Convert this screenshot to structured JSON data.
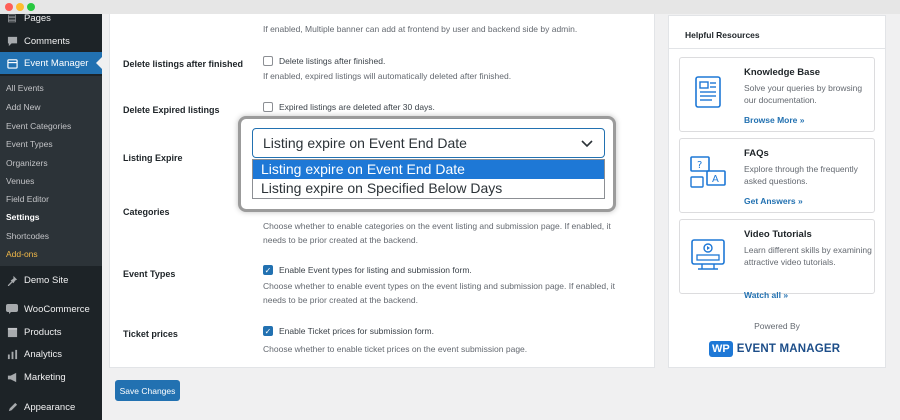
{
  "sidebar": {
    "items": [
      {
        "label": "Pages",
        "icon": "pages-icon"
      },
      {
        "label": "Comments",
        "icon": "comments-icon"
      },
      {
        "label": "Event Manager",
        "icon": "event-manager-icon"
      },
      {
        "label": "Demo Site",
        "icon": "pin-icon"
      },
      {
        "label": "WooCommerce",
        "icon": "woocommerce-icon"
      },
      {
        "label": "Products",
        "icon": "products-icon"
      },
      {
        "label": "Analytics",
        "icon": "analytics-icon"
      },
      {
        "label": "Marketing",
        "icon": "marketing-icon"
      },
      {
        "label": "Appearance",
        "icon": "appearance-icon"
      }
    ],
    "submenu": [
      "All Events",
      "Add New",
      "Event Categories",
      "Event Types",
      "Organizers",
      "Venues",
      "Field Editor",
      "Settings",
      "Shortcodes",
      "Add-ons"
    ]
  },
  "settings": {
    "top_desc": "If enabled, Multiple banner can add at frontend by user and backend side by admin.",
    "delete_after_finished": {
      "label": "Delete listings after finished",
      "checkbox_label": "Delete listings after finished.",
      "desc": "If enabled, expired listings will automatically deleted after finished."
    },
    "delete_expired": {
      "label": "Delete Expired listings",
      "checkbox_label": "Expired listings are deleted after 30 days."
    },
    "listing_expire": {
      "label": "Listing Expire",
      "selected": "Listing expire on Event End Date",
      "options": [
        "Listing expire on Event End Date",
        "Listing expire on Specified Below Days"
      ]
    },
    "categories": {
      "label": "Categories",
      "desc_line1": "Choose whether to enable categories on the event listing and submission page. If enabled, it",
      "desc_line2": "needs to be prior created at the backend."
    },
    "event_types": {
      "label": "Event Types",
      "checkbox_label": "Enable Event types for listing and submission form.",
      "desc_line1": "Choose whether to enable event types on the event listing and submission page. If enabled, it",
      "desc_line2": "needs to be prior created at the backend."
    },
    "ticket_prices": {
      "label": "Ticket prices",
      "checkbox_label": "Enable Ticket prices for submission form.",
      "desc": "Choose whether to enable ticket prices on the event submission page."
    },
    "save_label": "Save Changes"
  },
  "resources": {
    "title": "Helpful Resources",
    "cards": [
      {
        "title": "Knowledge Base",
        "text": "Solve your queries by browsing our documentation.",
        "link": "Browse More »",
        "icon": "knowledge-base-icon"
      },
      {
        "title": "FAQs",
        "text": "Explore through the frequently asked questions.",
        "link": "Get Answers »",
        "icon": "faq-icon"
      },
      {
        "title": "Video Tutorials",
        "text": "Learn different skills by examining attractive video tutorials.",
        "link": "Watch all »",
        "icon": "video-tutorial-icon"
      }
    ],
    "powered_by": "Powered By",
    "logo_badge": "WP",
    "logo_text": "EVENT MANAGER"
  },
  "colors": {
    "accent": "#2271b1",
    "sidebar_bg": "#1d2327",
    "highlight": "#1e78d6"
  }
}
